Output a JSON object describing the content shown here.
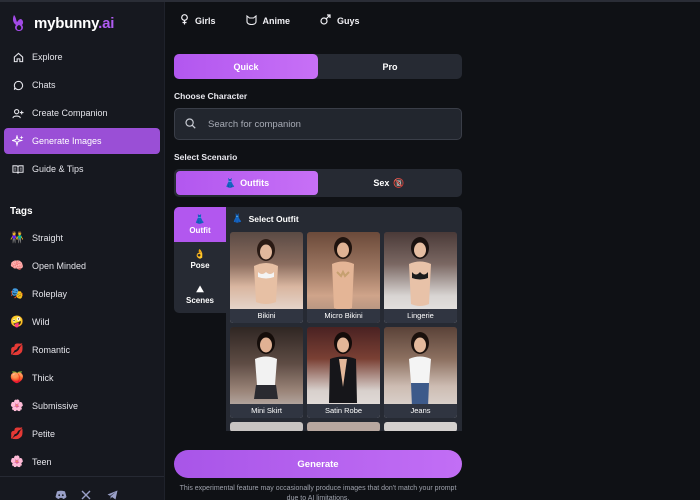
{
  "brand": {
    "name": "mybunny",
    "suffix": ".ai",
    "accent": "#b05cf2"
  },
  "topnav": [
    {
      "label": "Girls",
      "icon": "female-icon"
    },
    {
      "label": "Anime",
      "icon": "cat-face-icon"
    },
    {
      "label": "Guys",
      "icon": "male-icon"
    }
  ],
  "nav": [
    {
      "label": "Explore",
      "icon": "compass-icon",
      "active": false
    },
    {
      "label": "Chats",
      "icon": "chat-bubble-icon",
      "active": false
    },
    {
      "label": "Create Companion",
      "icon": "add-user-icon",
      "active": false
    },
    {
      "label": "Generate Images",
      "icon": "sparkle-icon",
      "active": true
    },
    {
      "label": "Guide & Tips",
      "icon": "book-icon",
      "active": false
    }
  ],
  "tags": {
    "title": "Tags",
    "items": [
      {
        "label": "Straight",
        "emoji": "👫"
      },
      {
        "label": "Open Minded",
        "emoji": "🧠"
      },
      {
        "label": "Roleplay",
        "emoji": "🎭"
      },
      {
        "label": "Wild",
        "emoji": "🤪"
      },
      {
        "label": "Romantic",
        "emoji": "💋"
      },
      {
        "label": "Thick",
        "emoji": "🍑"
      },
      {
        "label": "Submissive",
        "emoji": "🌸"
      },
      {
        "label": "Petite",
        "emoji": "💋"
      },
      {
        "label": "Teen",
        "emoji": "🌸"
      }
    ]
  },
  "mode": {
    "quick": "Quick",
    "pro": "Pro",
    "selected": "Quick"
  },
  "character": {
    "label": "Choose Character",
    "placeholder": "Search for companion"
  },
  "scenario": {
    "label": "Select Scenario",
    "options": [
      {
        "label": "Outfits",
        "emoji": "👗",
        "active": true
      },
      {
        "label": "Sex",
        "emoji": "🔞",
        "active": false
      }
    ]
  },
  "sidetabs": [
    {
      "label": "Outfit",
      "emoji": "👗",
      "active": true
    },
    {
      "label": "Pose",
      "emoji": "👌",
      "active": false
    },
    {
      "label": "Scenes",
      "emoji": "⛰",
      "active": false
    }
  ],
  "outfits": {
    "title": "Select Outfit",
    "emoji": "👗",
    "items": [
      "Bikini",
      "Micro Bikini",
      "Lingerie",
      "Mini Skirt",
      "Satin Robe",
      "Jeans"
    ]
  },
  "generate_label": "Generate",
  "disclaimer": "This experimental feature may occasionally produce images that don't match your prompt due to AI limitations."
}
